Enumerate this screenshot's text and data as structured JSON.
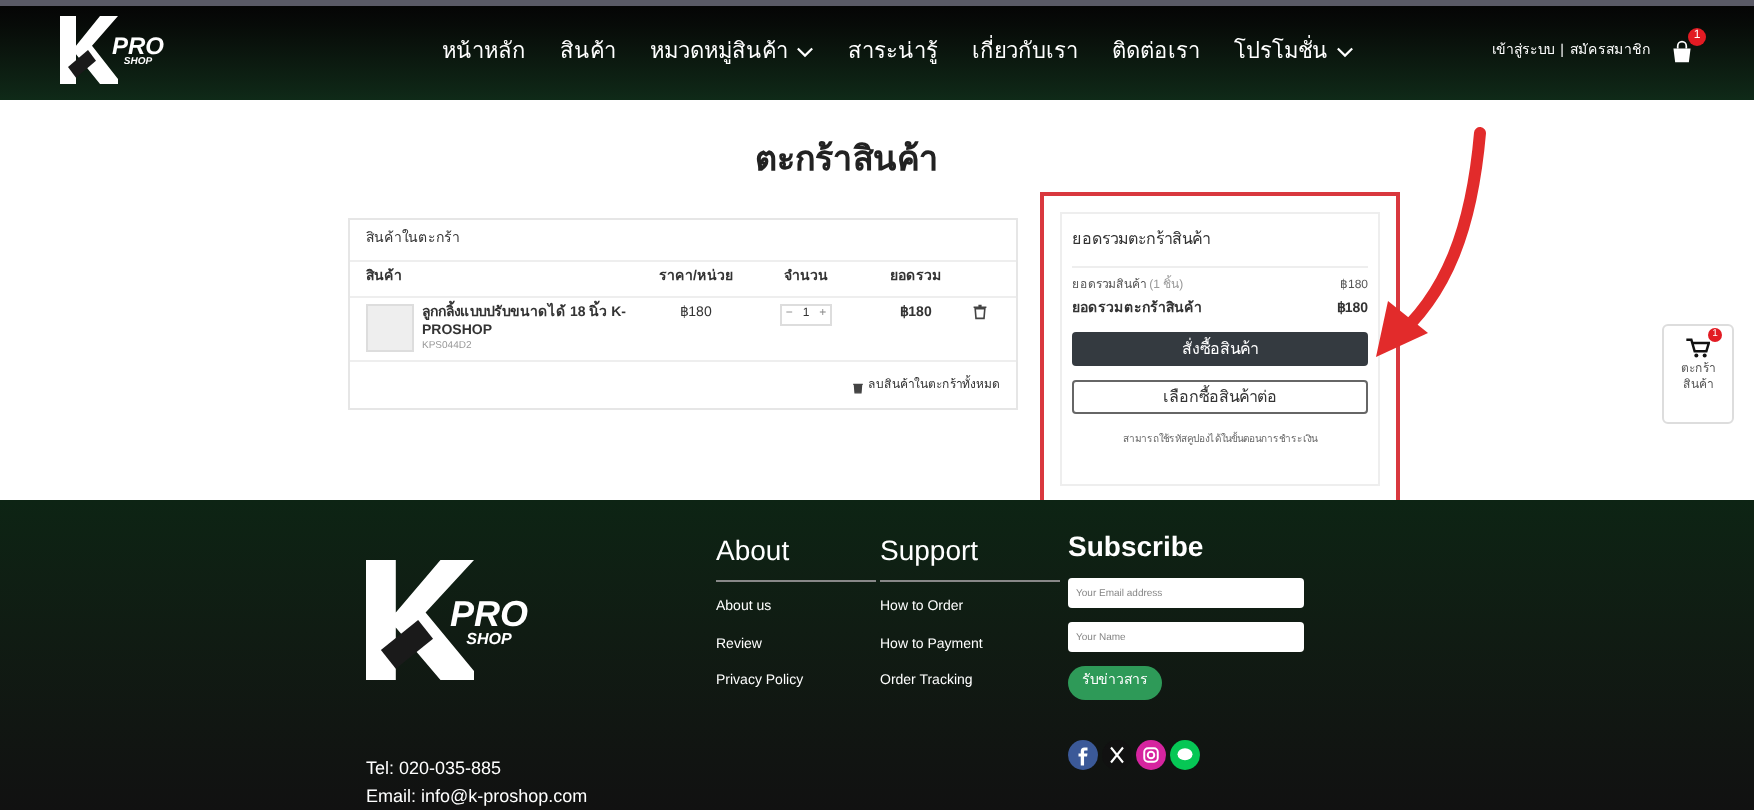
{
  "header": {
    "logo": {
      "pro": "PRO",
      "shop": "SHOP"
    },
    "nav": [
      {
        "label": "หน้าหลัก",
        "dropdown": false
      },
      {
        "label": "สินค้า",
        "dropdown": false
      },
      {
        "label": "หมวดหมู่สินค้า",
        "dropdown": true
      },
      {
        "label": "สาระน่ารู้",
        "dropdown": false
      },
      {
        "label": "เกี่ยวกับเรา",
        "dropdown": false
      },
      {
        "label": "ติดต่อเรา",
        "dropdown": false
      },
      {
        "label": "โปรโมชั่น",
        "dropdown": true
      }
    ],
    "login": "เข้าสู่ระบบ",
    "separator": "|",
    "register": "สมัครสมาชิก",
    "cart_count": "1"
  },
  "page_title": "ตะกร้าสินค้า",
  "cart": {
    "title": "สินค้าในตะกร้า",
    "columns": [
      "สินค้า",
      "ราคา/หน่วย",
      "จำนวน",
      "ยอดรวม"
    ],
    "items": [
      {
        "name": "ลูกกลิ้งแบบปรับขนาดได้ 18 นิ้ว K-PROSHOP",
        "sku": "KPS044D2",
        "price": "฿180",
        "qty_minus": "−",
        "qty": "1",
        "qty_plus": "+",
        "total": "฿180"
      }
    ],
    "clear": "ลบสินค้าในตะกร้าทั้งหมด"
  },
  "summary": {
    "title": "ยอดรวมตะกร้าสินค้า",
    "subtotal_label": "ยอดรวมสินค้า",
    "subtotal_count": "(1 ชิ้น)",
    "subtotal": "฿180",
    "total_label": "ยอดรวมตะกร้าสินค้า",
    "total": "฿180",
    "checkout": "สั่งซื้อสินค้า",
    "continue": "เลือกซื้อสินค้าต่อ",
    "note": "สามารถใช้รหัสคูปองได้ในขั้นตอนการชำระเงิน"
  },
  "floating_cart": {
    "count": "1",
    "label": "ตะกร้าสินค้า"
  },
  "footer": {
    "logo": {
      "pro": "PRO",
      "shop": "SHOP"
    },
    "tel": "Tel: 020-035-885",
    "email": "Email: info@k-proshop.com",
    "columns": [
      {
        "title": "About",
        "links": [
          "About us",
          "Review",
          "Privacy Policy"
        ]
      },
      {
        "title": "Support",
        "links": [
          "How to Order",
          "How to Payment",
          "Order Tracking"
        ]
      }
    ],
    "subscribe": {
      "title": "Subscribe",
      "email_placeholder": "Your Email address",
      "name_placeholder": "Your Name",
      "button": "รับข่าวสาร"
    },
    "social": [
      {
        "kind": "facebook"
      },
      {
        "kind": "x"
      },
      {
        "kind": "instagram"
      },
      {
        "kind": "line"
      }
    ]
  }
}
